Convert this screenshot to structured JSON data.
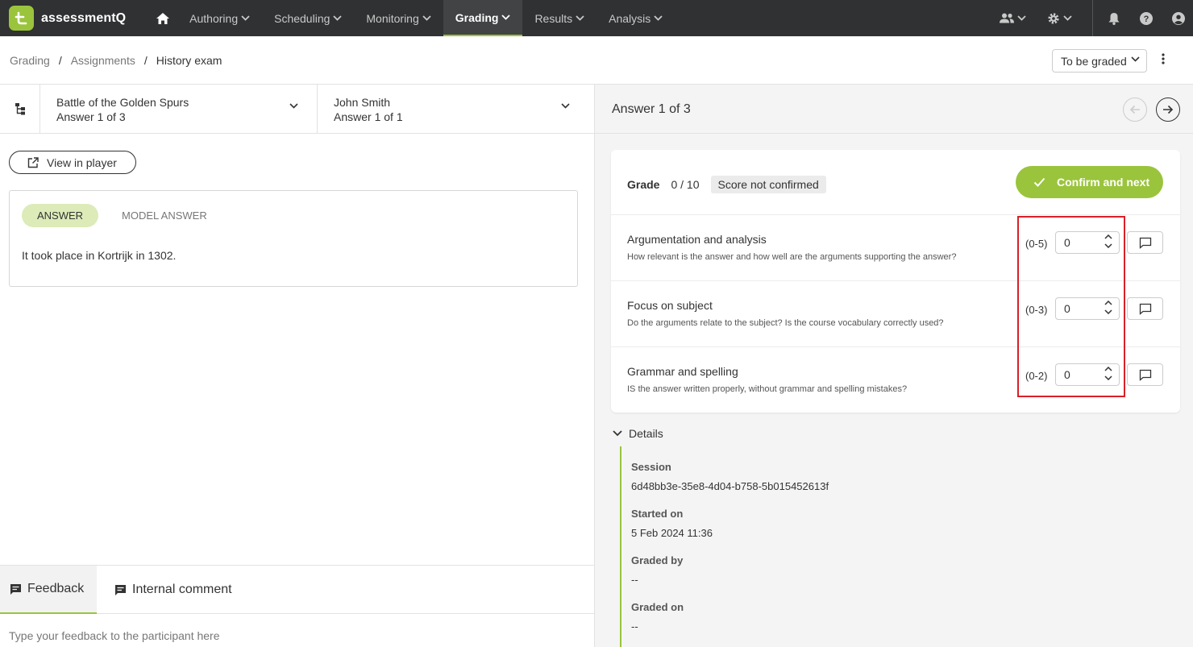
{
  "app": {
    "name": "assessmentQ",
    "brand_color": "#9ac43c"
  },
  "nav": {
    "items": [
      {
        "label": "Authoring"
      },
      {
        "label": "Scheduling"
      },
      {
        "label": "Monitoring"
      },
      {
        "label": "Grading",
        "active": true
      },
      {
        "label": "Results"
      },
      {
        "label": "Analysis"
      }
    ]
  },
  "breadcrumb": {
    "items": [
      "Grading",
      "Assignments",
      "History exam"
    ]
  },
  "filter": {
    "value": "To be graded"
  },
  "question_selector": {
    "title": "Battle of the Golden Spurs",
    "subtitle": "Answer 1 of 3"
  },
  "participant_selector": {
    "title": "John Smith",
    "subtitle": "Answer 1 of 1"
  },
  "view_in_player": {
    "label": "View in player"
  },
  "answer_tabs": {
    "answer": "ANSWER",
    "model": "MODEL ANSWER"
  },
  "answer_text": "It took place in Kortrijk in 1302.",
  "feedback": {
    "tab_feedback": "Feedback",
    "tab_internal": "Internal comment",
    "placeholder": "Type your feedback to the participant here"
  },
  "answer_header": {
    "title": "Answer 1 of 3"
  },
  "grade": {
    "label": "Grade",
    "value": "0 / 10",
    "status": "Score not confirmed",
    "confirm_label": "Confirm and next"
  },
  "criteria": [
    {
      "name": "Argumentation and analysis",
      "description": "How relevant is the answer and how well are the arguments supporting the answer?",
      "range": "(0-5)",
      "score": "0"
    },
    {
      "name": "Focus on subject",
      "description": "Do the arguments relate to the subject? Is the course vocabulary correctly used?",
      "range": "(0-3)",
      "score": "0"
    },
    {
      "name": "Grammar and spelling",
      "description": "IS the answer written properly, without grammar and spelling mistakes?",
      "range": "(0-2)",
      "score": "0"
    }
  ],
  "details": {
    "title": "Details",
    "session_label": "Session",
    "session_value": "6d48bb3e-35e8-4d04-b758-5b015452613f",
    "started_label": "Started on",
    "started_value": "5 Feb 2024 11:36",
    "graded_by_label": "Graded by",
    "graded_by_value": "--",
    "graded_on_label": "Graded on",
    "graded_on_value": "--"
  }
}
